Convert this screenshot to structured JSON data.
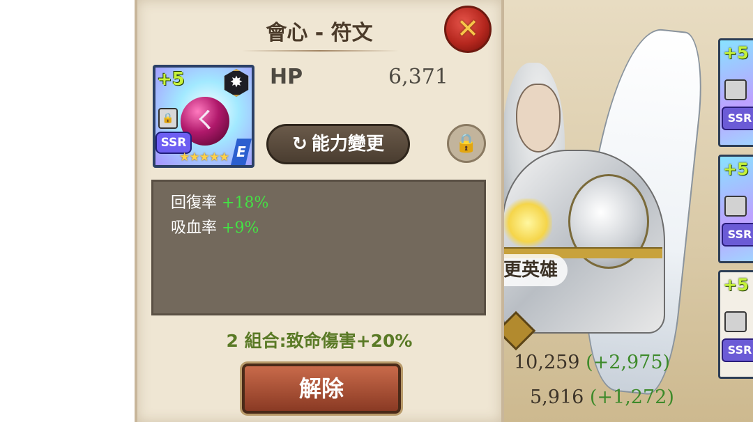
{
  "dialog": {
    "title": "會心 - 符文",
    "close_icon": "✕"
  },
  "rune": {
    "plus_level": "+5",
    "rarity": "SSR",
    "stars": "★★★★★",
    "tier": "E",
    "badge_icon": "✸",
    "orb_symbol": "ㄑ",
    "lock_icon": "🔒",
    "main_stat": {
      "name": "HP",
      "value": "6,371"
    },
    "sub_stats": [
      {
        "label": "回復率",
        "value": "+18%"
      },
      {
        "label": "吸血率",
        "value": "+9%"
      }
    ],
    "set_bonus": "2 組合:致命傷害+20%"
  },
  "buttons": {
    "change_ability": "能力變更",
    "change_ability_icon": "↻",
    "lock_icon": "🔒",
    "release": "解除"
  },
  "hero": {
    "change_hero_label": "更英雄",
    "stat_1": {
      "value": "10,259",
      "bonus": "(+2,975)"
    },
    "stat_2": {
      "value": "5,916",
      "bonus": "(+1,272)"
    }
  },
  "side_cards": [
    {
      "plus": "+5",
      "rarity": "SSR"
    },
    {
      "plus": "+5",
      "rarity": "SSR"
    },
    {
      "plus": "+5",
      "rarity": "SSR"
    }
  ]
}
